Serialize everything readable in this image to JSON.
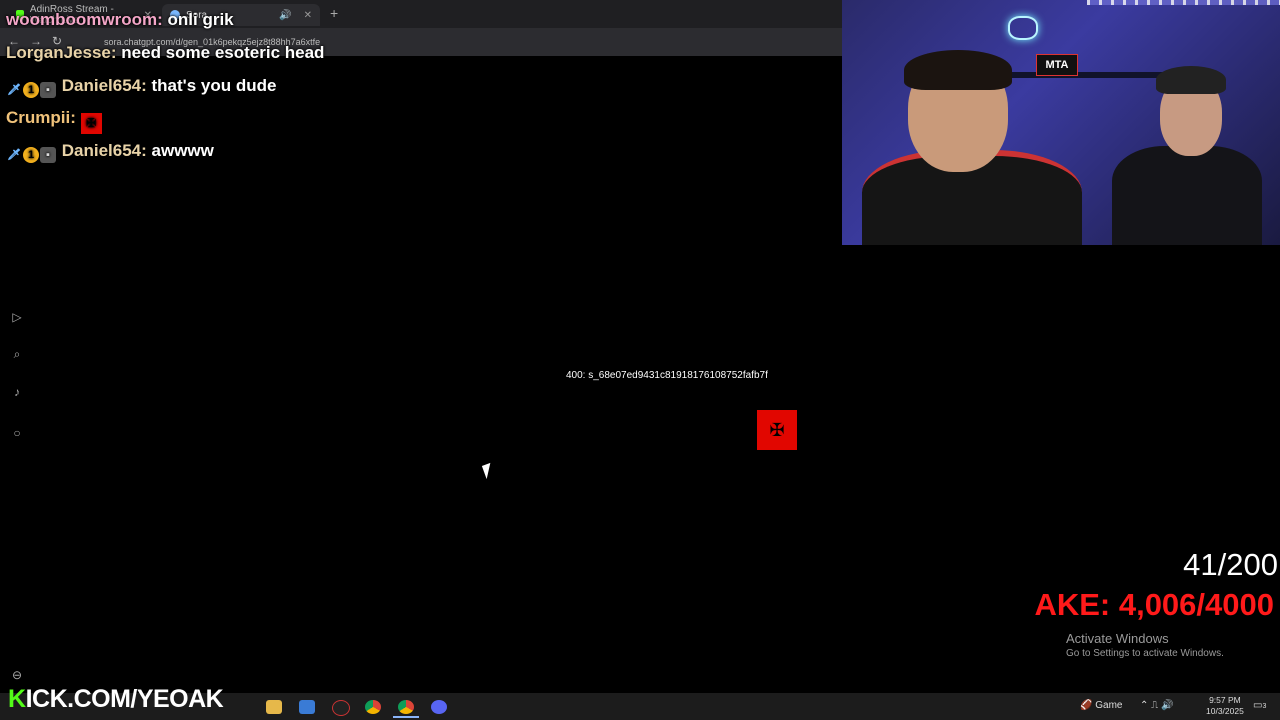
{
  "browser": {
    "tabs": [
      {
        "label": "AdinRoss Stream - Watch Live",
        "favicon_color": "#53fc18"
      },
      {
        "label": "Sora",
        "favicon_color": "#7ab8ff"
      }
    ],
    "add_tab": "+",
    "url": "sora.chatgpt.com/d/gen_01k6pekqz5ejz8t88hh7a6xtfe"
  },
  "chat": [
    {
      "badges": [],
      "user": "woomboomwroom:",
      "message": "onli grik",
      "user_color": "pink"
    },
    {
      "badges": [],
      "user": "LorganJesse:",
      "message": "need some esoteric head",
      "user_color": "tan"
    },
    {
      "badges": [
        "sword",
        "one",
        "cam"
      ],
      "user": "Daniel654:",
      "message": "that's you dude",
      "user_color": "tan"
    },
    {
      "badges": [],
      "user": "Crumpii:",
      "message": "",
      "emote": "albania-flag",
      "user_color": "gold"
    },
    {
      "badges": [
        "sword",
        "one",
        "cam"
      ],
      "user": "Daniel654:",
      "message": "awwww",
      "user_color": "tan"
    }
  ],
  "page": {
    "error": "400: s_68e07ed9431c81918176108752fafb7f",
    "emote": "albania-flag"
  },
  "webcam": {
    "sign": "MTA"
  },
  "overlay": {
    "goal_count": "41/200",
    "goal_bar": "AKE: 4,006/4000",
    "goal_bar_color": "#ff1a1a"
  },
  "windows": {
    "activate_title": "Activate Windows",
    "activate_sub": "Go to Settings to activate Windows."
  },
  "taskbar": {
    "brand": "KICK.COM/YEOAK",
    "brand_color": "#53fc18",
    "weather_label": "Game",
    "time": "9:57 PM",
    "date": "10/3/2025",
    "notifications": "3"
  }
}
